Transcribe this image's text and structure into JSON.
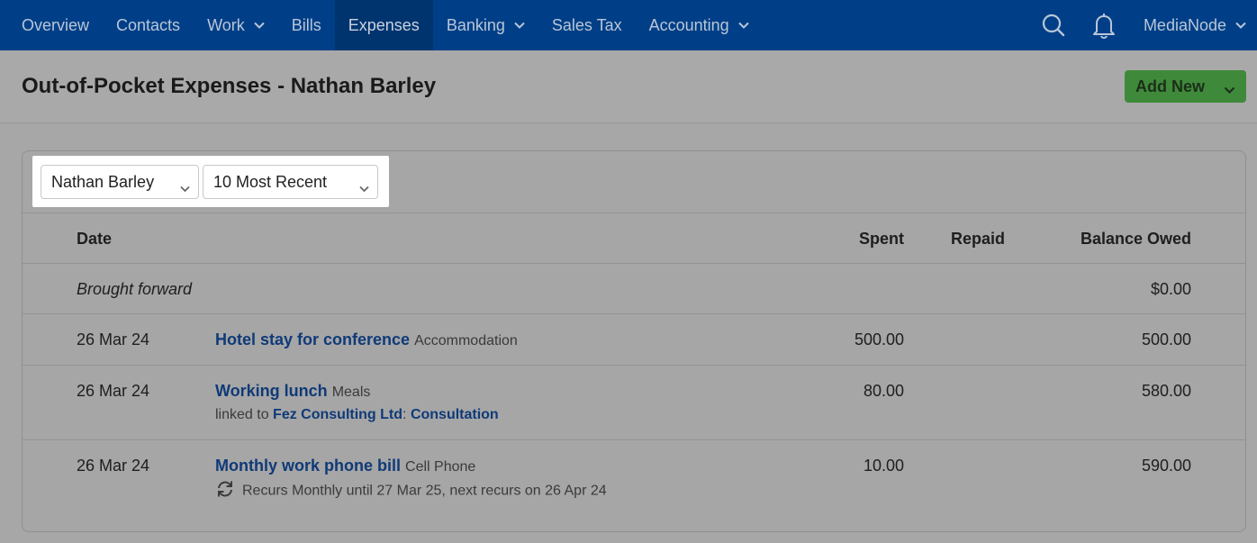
{
  "nav": {
    "items": [
      {
        "label": "Overview",
        "dropdown": false
      },
      {
        "label": "Contacts",
        "dropdown": false
      },
      {
        "label": "Work",
        "dropdown": true
      },
      {
        "label": "Bills",
        "dropdown": false
      },
      {
        "label": "Expenses",
        "dropdown": false,
        "active": true
      },
      {
        "label": "Banking",
        "dropdown": true
      },
      {
        "label": "Sales Tax",
        "dropdown": false
      },
      {
        "label": "Accounting",
        "dropdown": true
      }
    ],
    "account_label": "MediaNode"
  },
  "page": {
    "title": "Out-of-Pocket Expenses - Nathan Barley",
    "add_new_label": "Add New"
  },
  "filters": {
    "person": "Nathan Barley",
    "range": "10 Most Recent"
  },
  "table": {
    "headers": {
      "date": "Date",
      "spent": "Spent",
      "repaid": "Repaid",
      "balance": "Balance Owed"
    },
    "brought_forward": {
      "label": "Brought forward",
      "balance": "$0.00"
    },
    "rows": [
      {
        "date": "26 Mar 24",
        "description": "Hotel stay for conference",
        "category": "Accommodation",
        "spent": "500.00",
        "repaid": "",
        "balance": "500.00"
      },
      {
        "date": "26 Mar 24",
        "description": "Working lunch",
        "category": "Meals",
        "spent": "80.00",
        "repaid": "",
        "balance": "580.00",
        "linked_prefix": "linked to",
        "linked_contact": "Fez Consulting Ltd",
        "linked_separator": ":",
        "linked_project": "Consultation"
      },
      {
        "date": "26 Mar 24",
        "description": "Monthly work phone bill",
        "category": "Cell Phone",
        "spent": "10.00",
        "repaid": "",
        "balance": "590.00",
        "recur_text": "Recurs Monthly until 27 Mar 25, next recurs on 26 Apr 24"
      }
    ]
  },
  "colors": {
    "nav_bg": "#003f87",
    "add_new_bg": "#3f8a3a",
    "link": "#0f3a78"
  }
}
